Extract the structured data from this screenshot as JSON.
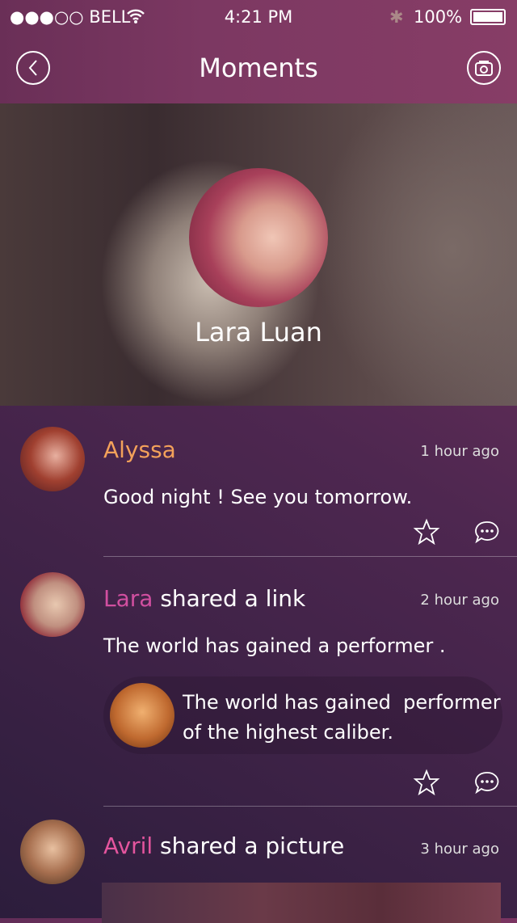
{
  "status": {
    "carrier": "●●●○○ BELL",
    "time": "4:21 PM",
    "battery": "100%"
  },
  "header": {
    "title": "Moments",
    "back_icon": "chevron-left-circle-icon",
    "camera_icon": "camera-circle-icon"
  },
  "profile": {
    "name": "Lara Luan"
  },
  "colors": {
    "alyssa": "#f3a15a",
    "lara": "#d14fa0",
    "avril": "#e4559e"
  },
  "posts": [
    {
      "name": "Alyssa",
      "action": "",
      "time": "1 hour ago",
      "text": "Good night ! See you tomorrow."
    },
    {
      "name": "Lara",
      "action": " shared a link",
      "time": "2 hour ago",
      "text": "The world has gained a performer .",
      "link_text": "The world has gained  performer\nof the highest caliber."
    },
    {
      "name": "Avril",
      "action": " shared a picture",
      "time": "3 hour ago"
    }
  ]
}
